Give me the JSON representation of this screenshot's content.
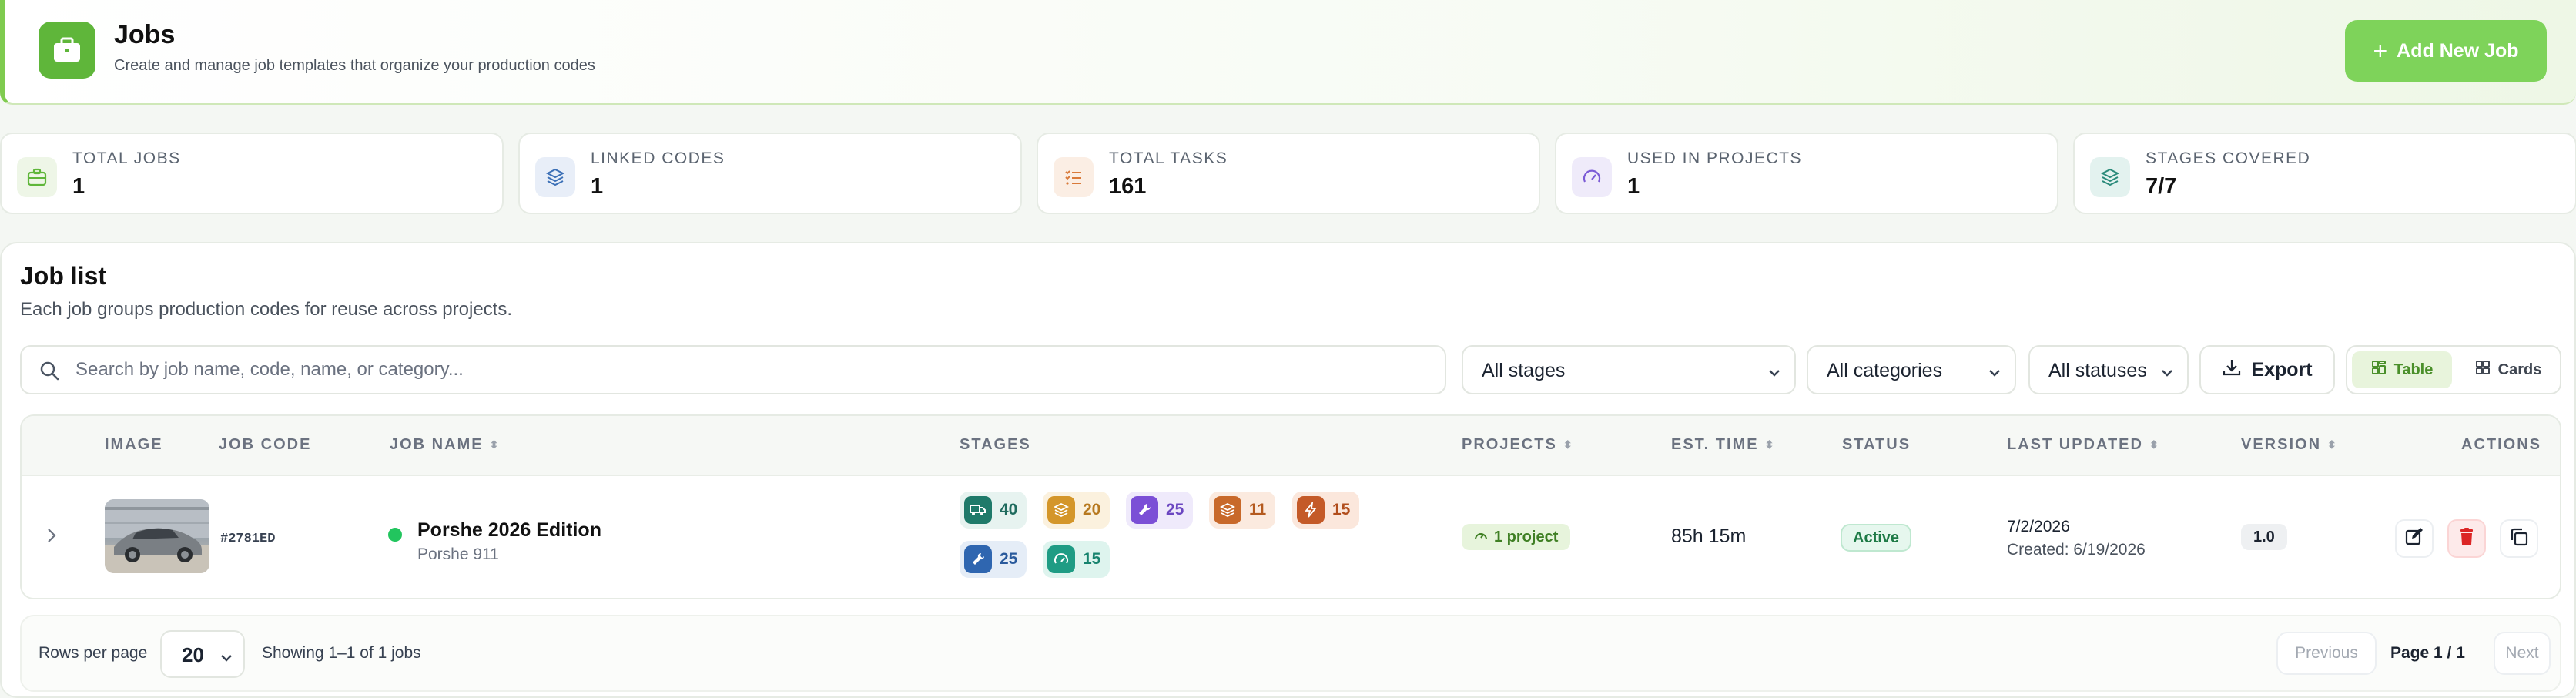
{
  "header": {
    "title": "Jobs",
    "subtitle": "Create and manage job templates that organize your production codes",
    "add_button": "Add New Job",
    "icon": "briefcase-icon"
  },
  "stats": [
    {
      "label": "TOTAL JOBS",
      "value": "1",
      "icon": "briefcase-icon",
      "color": "#5fb63a"
    },
    {
      "label": "LINKED CODES",
      "value": "1",
      "icon": "layers-icon",
      "color": "#3b6fb6"
    },
    {
      "label": "TOTAL TASKS",
      "value": "161",
      "icon": "checklist-icon",
      "color": "#d97a3a"
    },
    {
      "label": "USED IN PROJECTS",
      "value": "1",
      "icon": "gauge-icon",
      "color": "#7b5bd6"
    },
    {
      "label": "STAGES COVERED",
      "value": "7/7",
      "icon": "layers-icon",
      "color": "#2a8a7a"
    }
  ],
  "job_list": {
    "title": "Job list",
    "subtitle": "Each job groups production codes for reuse across projects.",
    "search_placeholder": "Search by job name, code, name, or category...",
    "filters": {
      "stages": "All stages",
      "categories": "All categories",
      "statuses": "All statuses"
    },
    "export_label": "Export",
    "view_table": "Table",
    "view_cards": "Cards"
  },
  "table": {
    "headers": {
      "image": "IMAGE",
      "job_code": "JOB CODE",
      "job_name": "JOB NAME",
      "stages": "STAGES",
      "projects": "PROJECTS",
      "est_time": "EST. TIME",
      "status": "STATUS",
      "last_updated": "LAST UPDATED",
      "version": "VERSION",
      "actions": "ACTIONS"
    },
    "rows": [
      {
        "job_code": "#2781ED",
        "job_name": "Porshe 2026 Edition",
        "job_sub": "Porshe 911",
        "status_color": "#22c55e",
        "stages": [
          {
            "count": "40",
            "icon": "truck-icon",
            "bg": "#e7f3f0",
            "sq": "#1f7a6a",
            "fg": "#1f6b5e"
          },
          {
            "count": "20",
            "icon": "layers-icon",
            "bg": "#fbf1de",
            "sq": "#d4962a",
            "fg": "#b7791f"
          },
          {
            "count": "25",
            "icon": "wrench-icon",
            "bg": "#efeafb",
            "sq": "#7b4fd6",
            "fg": "#6b46c1"
          },
          {
            "count": "11",
            "icon": "layers-icon",
            "bg": "#fbeadf",
            "sq": "#c8692a",
            "fg": "#b45a1f"
          },
          {
            "count": "15",
            "icon": "bolt-icon",
            "bg": "#fbe7dc",
            "sq": "#c45a28",
            "fg": "#b14d1c"
          },
          {
            "count": "25",
            "icon": "wrench-icon",
            "bg": "#e5edf7",
            "sq": "#2f66b0",
            "fg": "#2a5a9c"
          },
          {
            "count": "15",
            "icon": "gauge-icon",
            "bg": "#def4ee",
            "sq": "#1f9c84",
            "fg": "#17836e"
          }
        ],
        "projects": "1 project",
        "est_time": "85h 15m",
        "status": "Active",
        "updated": "7/2/2026",
        "created": "Created: 6/19/2026",
        "version": "1.0"
      }
    ]
  },
  "footer": {
    "rows_label": "Rows per page",
    "rows_value": "20",
    "showing": "Showing 1–1 of 1 jobs",
    "previous": "Previous",
    "page": "Page 1 / 1",
    "next": "Next"
  }
}
